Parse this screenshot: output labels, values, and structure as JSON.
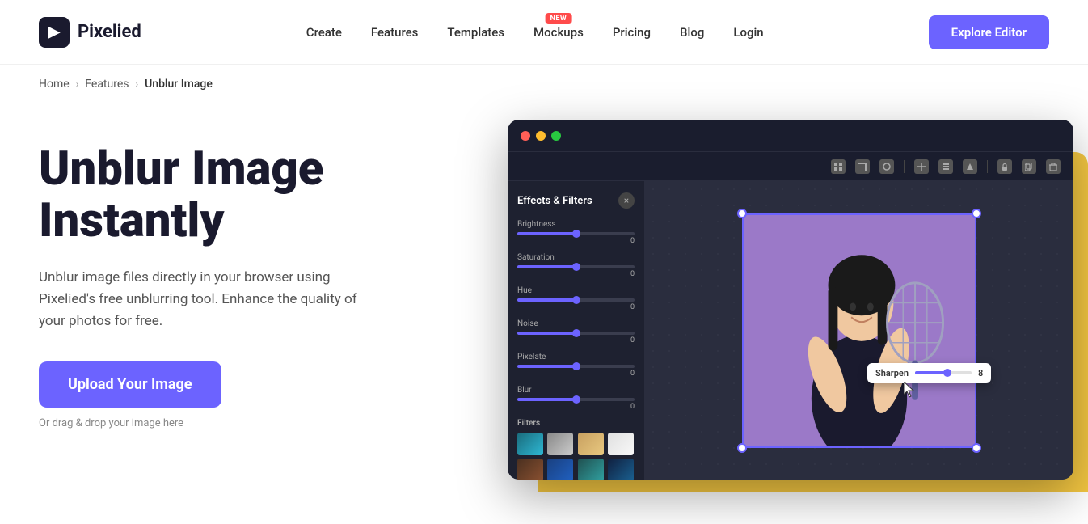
{
  "logo": {
    "icon": "▶",
    "text": "Pixelied"
  },
  "nav": {
    "links": [
      {
        "label": "Create",
        "id": "create"
      },
      {
        "label": "Features",
        "id": "features"
      },
      {
        "label": "Templates",
        "id": "templates"
      },
      {
        "label": "Mockups",
        "id": "mockups",
        "badge": "NEW"
      },
      {
        "label": "Pricing",
        "id": "pricing"
      },
      {
        "label": "Blog",
        "id": "blog"
      },
      {
        "label": "Login",
        "id": "login"
      }
    ],
    "cta": "Explore Editor"
  },
  "breadcrumb": {
    "home": "Home",
    "features": "Features",
    "current": "Unblur Image"
  },
  "hero": {
    "title_line1": "Unblur Image",
    "title_line2": "Instantly",
    "description": "Unblur image files directly in your browser using Pixelied's free unblurring tool. Enhance the quality of your photos for free.",
    "upload_btn": "Upload Your Image",
    "drag_text": "Or drag & drop your image here"
  },
  "editor": {
    "panel_title": "Effects & Filters",
    "close_btn": "×",
    "sliders": [
      {
        "label": "Brightness",
        "value": "0",
        "fill_pct": 50
      },
      {
        "label": "Saturation",
        "value": "0",
        "fill_pct": 50
      },
      {
        "label": "Hue",
        "value": "0",
        "fill_pct": 50
      },
      {
        "label": "Noise",
        "value": "0",
        "fill_pct": 50
      },
      {
        "label": "Pixelate",
        "value": "0",
        "fill_pct": 50
      },
      {
        "label": "Blur",
        "value": "0",
        "fill_pct": 50
      }
    ],
    "filters_title": "Filters",
    "sharpen": {
      "label": "Sharpen",
      "value": "8"
    }
  }
}
